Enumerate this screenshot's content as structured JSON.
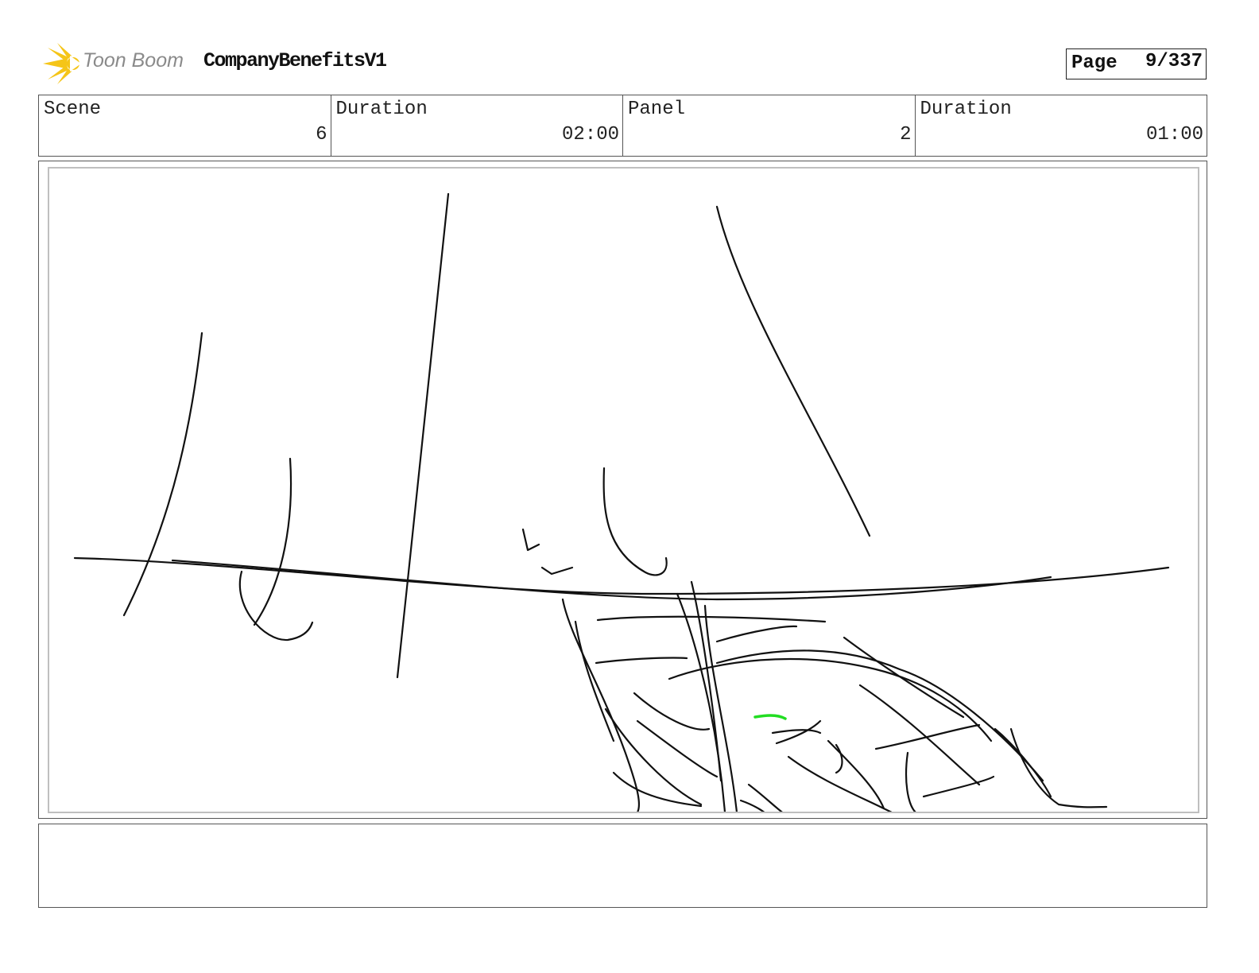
{
  "header": {
    "logo_text": "Toon Boom",
    "doc_title": "CompanyBenefitsV1",
    "page_label": "Page",
    "page_value": "9/337"
  },
  "info": [
    {
      "label": "Scene",
      "value": "6"
    },
    {
      "label": "Duration",
      "value": "02:00"
    },
    {
      "label": "Panel",
      "value": "2"
    },
    {
      "label": "Duration",
      "value": "01:00"
    }
  ],
  "colors": {
    "logo_star": "#f5c518",
    "sketch_line": "#111111",
    "sketch_accent": "#22dd22"
  },
  "notes": ""
}
